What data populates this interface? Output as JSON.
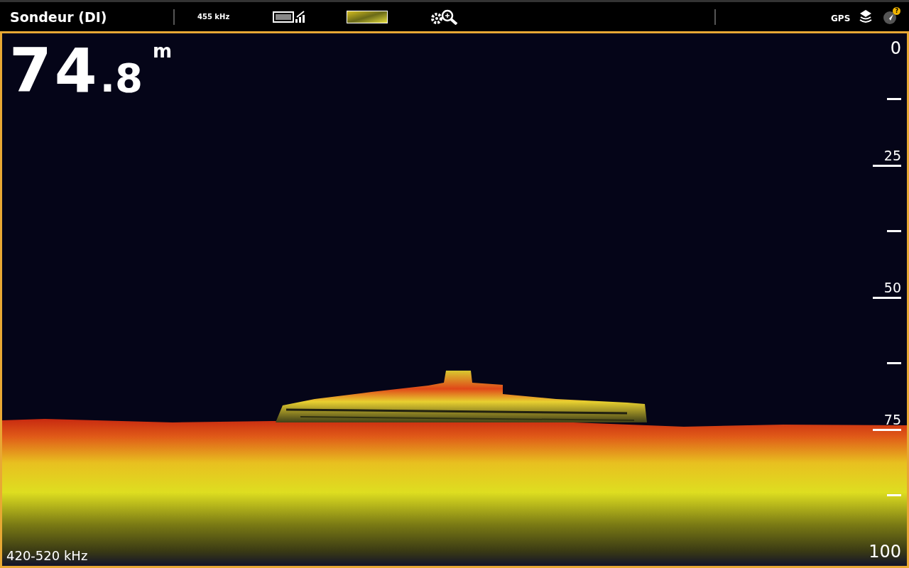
{
  "status_bar": {
    "title": "Sondeur (DI)",
    "frequency": "455 kHz",
    "gps_label": "GPS",
    "alert_badge": "?"
  },
  "sonar": {
    "depth_whole": "74",
    "depth_fraction": ".8",
    "depth_unit": "m",
    "frequency_range": "420-520 kHz",
    "scale": [
      {
        "kind": "label",
        "label": "0"
      },
      {
        "kind": "tick"
      },
      {
        "kind": "labeled_tick",
        "label": "25"
      },
      {
        "kind": "tick"
      },
      {
        "kind": "labeled_tick",
        "label": "50"
      },
      {
        "kind": "tick"
      },
      {
        "kind": "labeled_tick",
        "label": "75"
      },
      {
        "kind": "tick"
      },
      {
        "kind": "label",
        "label": "100"
      }
    ]
  }
}
